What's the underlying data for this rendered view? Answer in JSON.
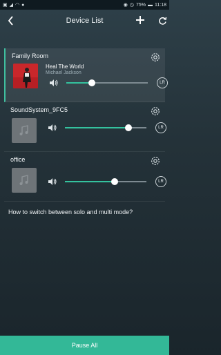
{
  "status_bar": {
    "battery_pct": "75%",
    "time": "11:18"
  },
  "header": {
    "title": "Device List"
  },
  "devices": [
    {
      "name": "Family Room",
      "song": "Heal The World",
      "artist": "Michael Jackson",
      "volume_fraction": 0.31,
      "channel": "LR",
      "active": true
    },
    {
      "name": "SoundSystem_9FC5",
      "volume_fraction": 0.78,
      "channel": "LR"
    },
    {
      "name": "office",
      "volume_fraction": 0.61,
      "channel": "LR"
    }
  ],
  "help_text": "How to switch between solo and multi mode?",
  "footer": {
    "pause_all_label": "Pause All"
  },
  "colors": {
    "accent": "#34c29e",
    "footer_bg": "#33b897"
  }
}
